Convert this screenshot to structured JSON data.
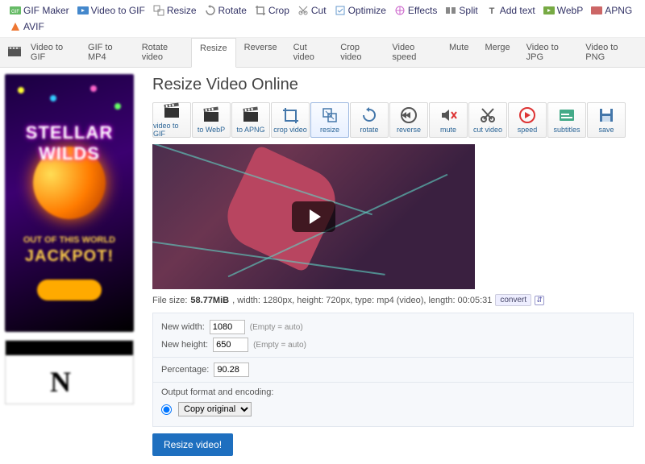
{
  "topnav": [
    {
      "label": "GIF Maker",
      "icon": "gif"
    },
    {
      "label": "Video to GIF",
      "icon": "vid"
    },
    {
      "label": "Resize",
      "icon": "resize"
    },
    {
      "label": "Rotate",
      "icon": "rotate"
    },
    {
      "label": "Crop",
      "icon": "crop"
    },
    {
      "label": "Cut",
      "icon": "cut"
    },
    {
      "label": "Optimize",
      "icon": "opt"
    },
    {
      "label": "Effects",
      "icon": "fx"
    },
    {
      "label": "Split",
      "icon": "split"
    },
    {
      "label": "Add text",
      "icon": "text"
    },
    {
      "label": "WebP",
      "icon": "webp"
    },
    {
      "label": "APNG",
      "icon": "apng"
    },
    {
      "label": "AVIF",
      "icon": "avif"
    }
  ],
  "subnav": {
    "items": [
      "Video to GIF",
      "GIF to MP4",
      "Rotate video",
      "Resize",
      "Reverse",
      "Cut video",
      "Crop video",
      "Video speed",
      "Mute",
      "Merge",
      "Video to JPG",
      "Video to PNG"
    ],
    "active": 3
  },
  "page": {
    "title": "Resize Video Online"
  },
  "toolbar": [
    {
      "id": "video-to-gif",
      "label": "video to GIF",
      "icon": "clap"
    },
    {
      "id": "to-webp",
      "label": "to WebP",
      "icon": "clap"
    },
    {
      "id": "to-apng",
      "label": "to APNG",
      "icon": "clap"
    },
    {
      "id": "crop-video",
      "label": "crop video",
      "icon": "crop2"
    },
    {
      "id": "resize",
      "label": "resize",
      "icon": "resize2",
      "active": true
    },
    {
      "id": "rotate",
      "label": "rotate",
      "icon": "rotate2"
    },
    {
      "id": "reverse",
      "label": "reverse",
      "icon": "rewind"
    },
    {
      "id": "mute",
      "label": "mute",
      "icon": "mute"
    },
    {
      "id": "cut-video",
      "label": "cut video",
      "icon": "scissors"
    },
    {
      "id": "speed",
      "label": "speed",
      "icon": "speed"
    },
    {
      "id": "subtitles",
      "label": "subtitles",
      "icon": "sub"
    },
    {
      "id": "save",
      "label": "save",
      "icon": "save"
    }
  ],
  "meta": {
    "prefix": "File size: ",
    "size": "58.77MiB",
    "rest": ", width: 1280px, height: 720px, type: mp4 (video), length: 00:05:31",
    "convert": "convert"
  },
  "form": {
    "width_label": "New width:",
    "width": "1080",
    "height_label": "New height:",
    "height": "650",
    "hint": "(Empty = auto)",
    "percentage_label": "Percentage:",
    "percentage": "90.28",
    "output_label": "Output format and encoding:",
    "output_value": "Copy original",
    "submit": "Resize video!"
  },
  "ad1": {
    "line1": "STELLAR",
    "line2": "WILDS",
    "mid": "OUT OF THIS WORLD",
    "jack": "JACKPOT!"
  }
}
